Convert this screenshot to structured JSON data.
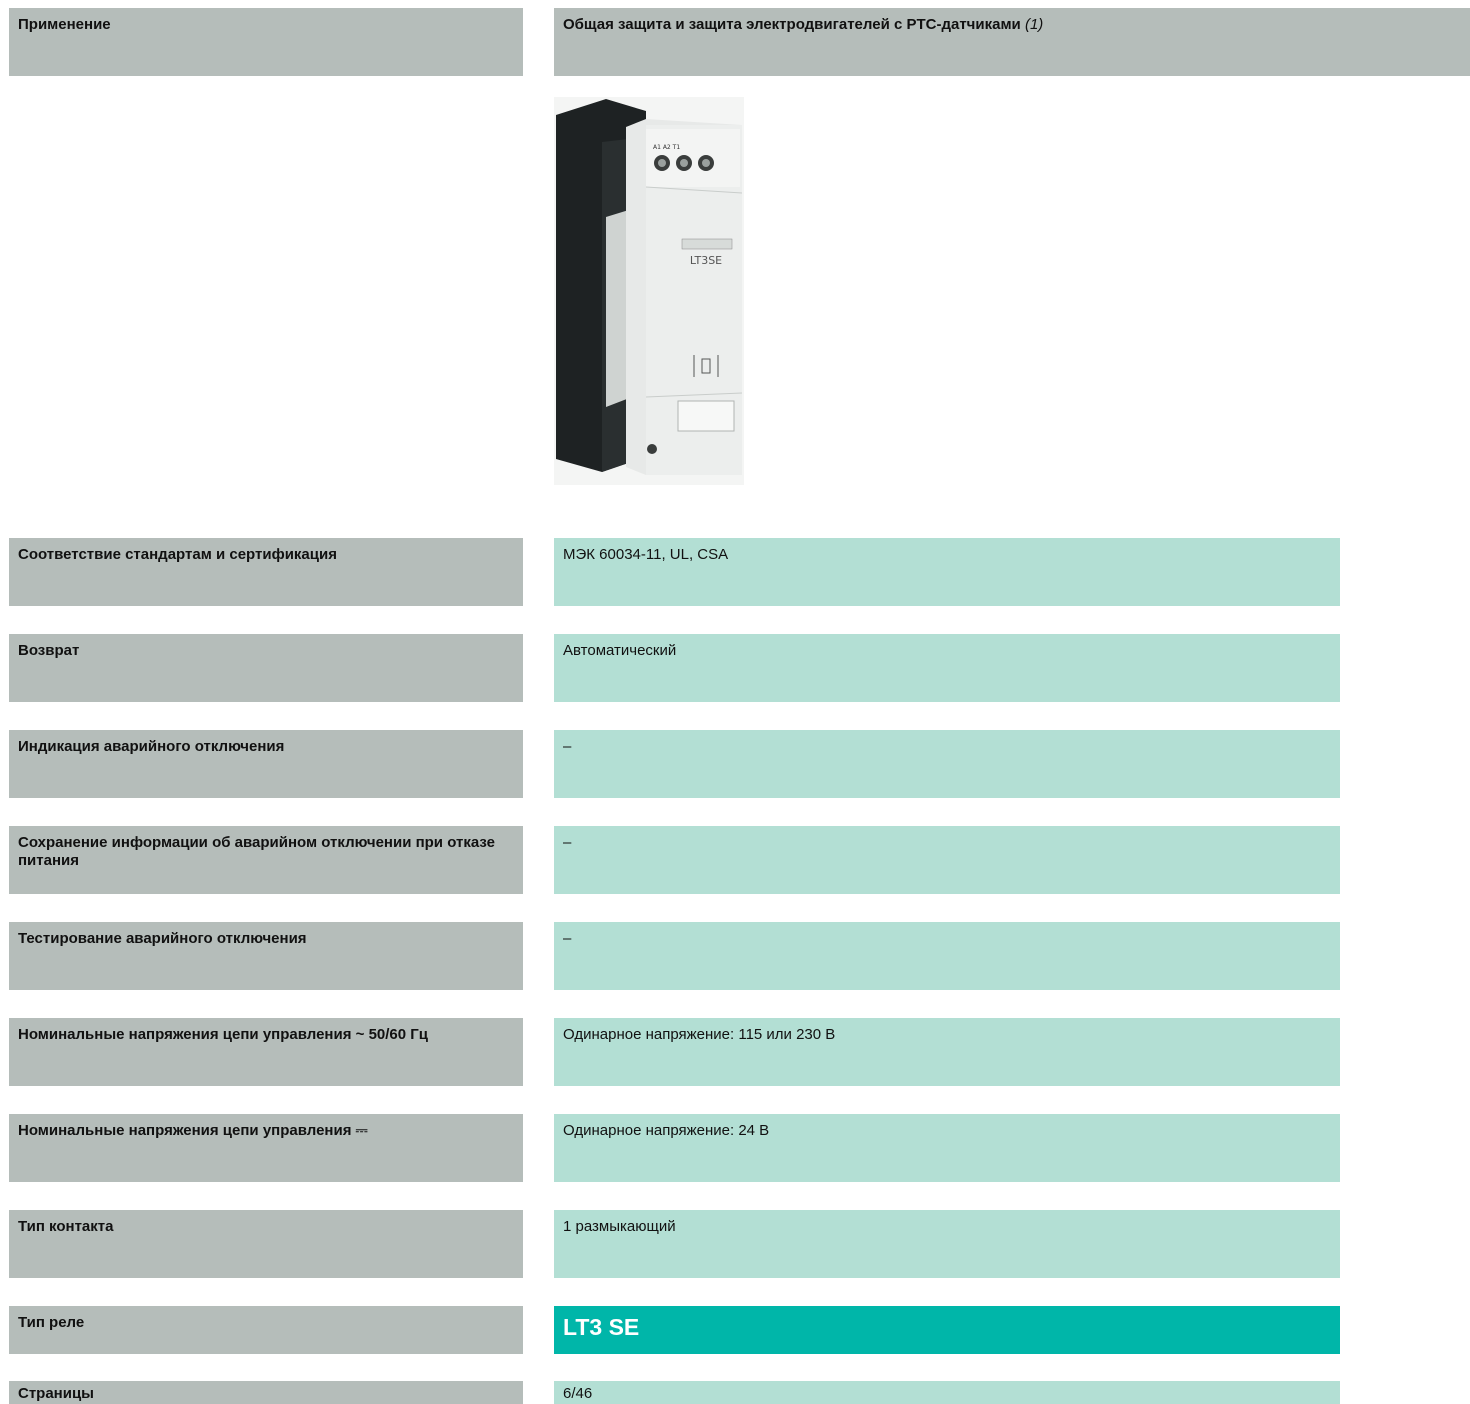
{
  "header": {
    "label": "Применение",
    "title": "Общая защита и защита электродвигателей с PTC-датчиками",
    "note": "(1)"
  },
  "product_image": {
    "device_text": "LT3SE",
    "colors": {
      "housing": "#eceeed",
      "side": "#1e2223"
    }
  },
  "rows": [
    {
      "label": "Соответствие стандартам и сертификация",
      "value": "МЭК 60034-11, UL, CSA"
    },
    {
      "label": "Возврат",
      "value": "Автоматический"
    },
    {
      "label": "Индикация аварийного отключения",
      "value": "–"
    },
    {
      "label": "Сохранение информации об аварийном отключении при отказе питания",
      "value": "–"
    },
    {
      "label": "Тестирование аварийного отключения",
      "value": "–"
    },
    {
      "label_main": "Номинальные напряжения цепи управления",
      "label_symbol": "~",
      "label_tail": "50/60 Гц",
      "value": "Одинарное напряжение: 115 или 230 В"
    },
    {
      "label_main": "Номинальные напряжения цепи управления",
      "label_symbol": "⎓",
      "value": "Одинарное напряжение: 24 В"
    },
    {
      "label": "Тип контакта",
      "value": "1 размыкающий"
    },
    {
      "label": "Тип реле",
      "value": "LT3 SE"
    },
    {
      "label": "Страницы",
      "value": "6/46"
    }
  ],
  "colors": {
    "label_bg": "#b5bdba",
    "value_bg": "#b3dfd4",
    "highlight_bg": "#00b6a9"
  }
}
